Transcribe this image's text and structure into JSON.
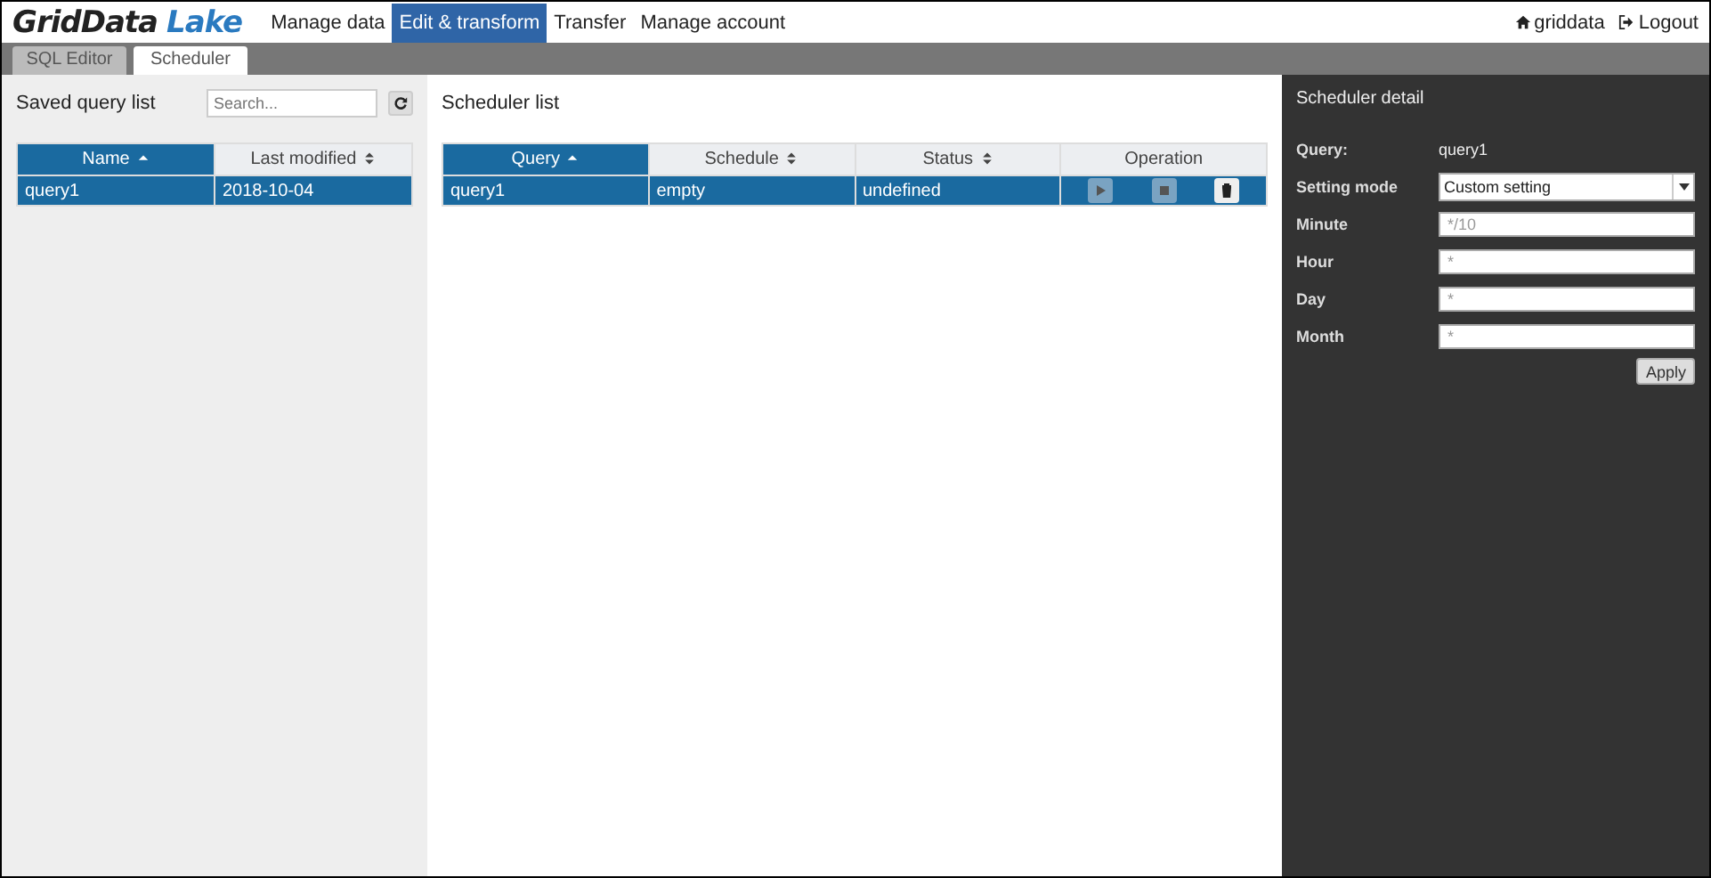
{
  "brand": {
    "first": "GridData",
    "second": "Lake"
  },
  "nav": [
    {
      "label": "Manage data",
      "selected": false
    },
    {
      "label": "Edit & transform",
      "selected": true
    },
    {
      "label": "Transfer",
      "selected": false
    },
    {
      "label": "Manage account",
      "selected": false
    }
  ],
  "user": {
    "name": "griddata",
    "logout": "Logout"
  },
  "tabs": [
    {
      "label": "SQL Editor",
      "selected": false
    },
    {
      "label": "Scheduler",
      "selected": true
    }
  ],
  "saved_queries": {
    "title": "Saved query list",
    "search": {
      "placeholder": "Search..."
    },
    "columns": [
      {
        "label": "Name",
        "kind": "sorted"
      },
      {
        "label": "Last modified",
        "kind": "sortable"
      }
    ],
    "rows": [
      {
        "cells": [
          "query1",
          "2018-10-04"
        ],
        "selected": true
      }
    ]
  },
  "scheduler_list": {
    "title": "Scheduler list",
    "columns": [
      {
        "label": "Query",
        "kind": "sorted"
      },
      {
        "label": "Schedule",
        "kind": "sortable"
      },
      {
        "label": "Status",
        "kind": "sortable"
      },
      {
        "label": "Operation",
        "kind": "plain"
      }
    ],
    "rows": [
      {
        "cells": [
          "query1",
          "empty",
          "undefined"
        ],
        "selected": true,
        "operations": [
          {
            "kind": "play",
            "disabled": true
          },
          {
            "kind": "stop",
            "disabled": true
          },
          {
            "kind": "delete",
            "disabled": false
          }
        ]
      }
    ]
  },
  "detail": {
    "title": "Scheduler detail",
    "query_label": "Query:",
    "query_value": "query1",
    "mode_label": "Setting mode",
    "mode_value": "Custom setting",
    "fields": [
      {
        "label": "Minute",
        "placeholder": "*/10"
      },
      {
        "label": "Hour",
        "placeholder": "*"
      },
      {
        "label": "Day",
        "placeholder": "*"
      },
      {
        "label": "Month",
        "placeholder": "*"
      }
    ],
    "apply": "Apply"
  }
}
